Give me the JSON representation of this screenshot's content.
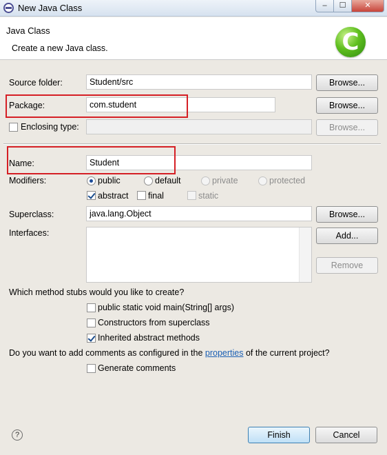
{
  "window": {
    "title": "New Java Class",
    "controls": {
      "minimize": "–",
      "maximize": "☐",
      "close": "✕"
    }
  },
  "header": {
    "title": "Java Class",
    "description": "Create a new Java class.",
    "logo_letter": "C"
  },
  "form": {
    "source_folder": {
      "label": "Source folder:",
      "value": "Student/src",
      "browse": "Browse..."
    },
    "package": {
      "label": "Package:",
      "value": "com.student",
      "browse": "Browse..."
    },
    "enclosing_type": {
      "label": "Enclosing type:",
      "value": "",
      "checked": false,
      "browse": "Browse..."
    },
    "name": {
      "label": "Name:",
      "value": "Student"
    },
    "modifiers": {
      "label": "Modifiers:",
      "access": [
        {
          "label": "public",
          "selected": true,
          "enabled": true
        },
        {
          "label": "default",
          "selected": false,
          "enabled": true
        },
        {
          "label": "private",
          "selected": false,
          "enabled": false
        },
        {
          "label": "protected",
          "selected": false,
          "enabled": false
        }
      ],
      "flags": [
        {
          "label": "abstract",
          "checked": true,
          "enabled": true
        },
        {
          "label": "final",
          "checked": false,
          "enabled": true
        },
        {
          "label": "static",
          "checked": false,
          "enabled": false
        }
      ]
    },
    "superclass": {
      "label": "Superclass:",
      "value": "java.lang.Object",
      "browse": "Browse..."
    },
    "interfaces": {
      "label": "Interfaces:",
      "add": "Add...",
      "remove": "Remove"
    }
  },
  "stubs": {
    "question": "Which method stubs would you like to create?",
    "options": [
      {
        "label": "public static void main(String[] args)",
        "checked": false
      },
      {
        "label": "Constructors from superclass",
        "checked": false
      },
      {
        "label": "Inherited abstract methods",
        "checked": true
      }
    ]
  },
  "comments": {
    "question_prefix": "Do you want to add comments as configured in the",
    "link": "properties",
    "question_suffix": "of the current project?",
    "generate": {
      "label": "Generate comments",
      "checked": false
    }
  },
  "footer": {
    "help": "?",
    "finish": "Finish",
    "cancel": "Cancel"
  },
  "colors": {
    "highlight": "#d51e24",
    "link": "#1a5fb4"
  }
}
